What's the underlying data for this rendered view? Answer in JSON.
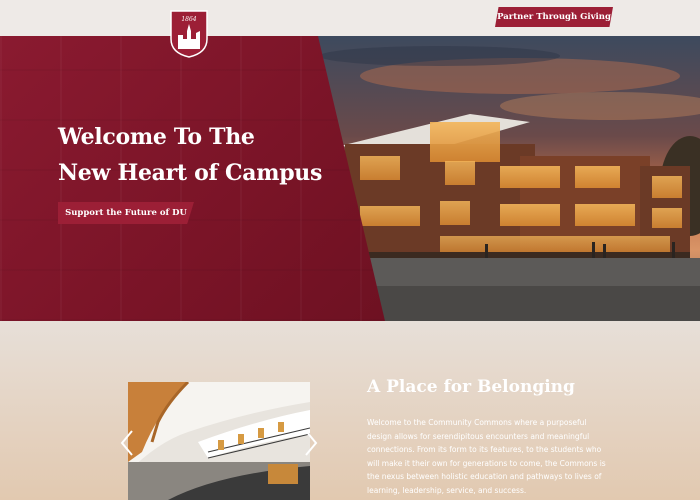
{
  "header": {
    "crest_year": "1864",
    "partner_button_label": "Partner Through Giving"
  },
  "hero": {
    "title_line1": "Welcome To The",
    "title_line2": "New Heart of Campus",
    "cta_label": "Support the Future of DU"
  },
  "belonging": {
    "title": "A Place for Belonging",
    "body": "Welcome to the Community Commons where a purposeful design allows for serendipitous encounters and meaningful connections. From its form to its features, to the students who will make it their own for generations to come, the Commons is the nexus between holistic education and pathways to lives of learning, leadership, service, and success."
  },
  "gallery": {
    "prev_icon": "chevron-left-icon",
    "next_icon": "chevron-right-icon"
  },
  "colors": {
    "brand_crimson": "#9c1f36",
    "panel_crimson": "#7a1427",
    "page_bg": "#ece6e1"
  }
}
